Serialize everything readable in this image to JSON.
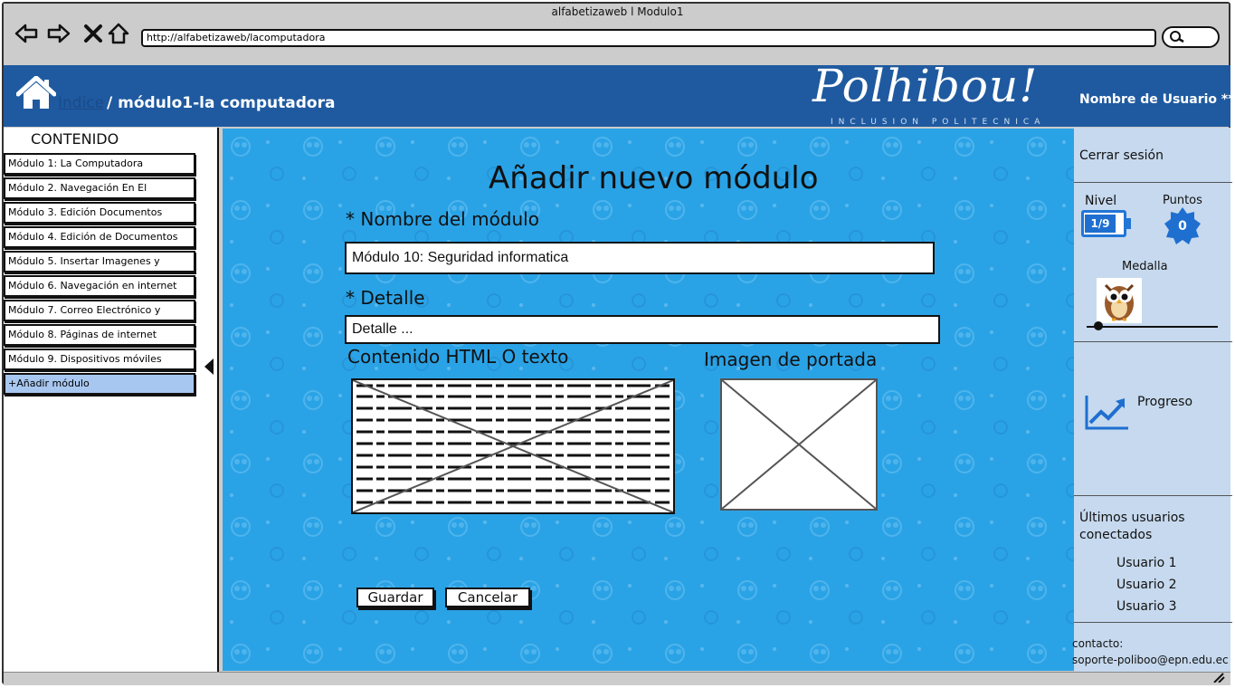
{
  "window": {
    "title": "alfabetizaweb l Modulo1",
    "url": "http://alfabetizaweb/lacomputadora"
  },
  "header": {
    "breadcrumb_link": "Indice",
    "breadcrumb_current": "/ módulo1-la computadora",
    "logo": "Polhibou!",
    "logo_subtitle": "INCLUSION POLITECNICA",
    "username": "Nombre de Usuario **"
  },
  "sidebar": {
    "title": "CONTENIDO",
    "items": [
      {
        "label": "Módulo 1: La Computadora"
      },
      {
        "label": "Módulo 2. Navegación En El"
      },
      {
        "label": "Módulo 3. Edición Documentos"
      },
      {
        "label": "Módulo 4. Edición de Documentos"
      },
      {
        "label": "Módulo 5. Insertar Imagenes y"
      },
      {
        "label": "Módulo 6. Navegación en internet"
      },
      {
        "label": "Módulo 7. Correo Electrónico y"
      },
      {
        "label": "Módulo 8. Páginas de internet"
      },
      {
        "label": "Módulo 9. Dispositivos móviles"
      },
      {
        "label": "+Añadir módulo"
      }
    ]
  },
  "form": {
    "title": "Añadir nuevo módulo",
    "name_label": "* Nombre del módulo",
    "name_value": "Módulo 10: Seguridad informatica",
    "detail_label": "* Detalle",
    "detail_value": "Detalle ...",
    "html_label": "Contenido HTML O texto",
    "cover_label": "Imagen de portada",
    "save_label": "Guardar",
    "cancel_label": "Cancelar"
  },
  "right_panel": {
    "logout": "Cerrar sesión",
    "level_label": "Nivel",
    "level_value": "1/9",
    "points_label": "Puntos",
    "points_value": "0",
    "medal_label": "Medalla",
    "progress_label": "Progreso",
    "last_users_title": "Últimos usuarios conectados",
    "users": [
      "Usuario 1",
      "Usuario 2",
      "Usuario 3"
    ],
    "contact_label": "contacto:",
    "contact_email": "soporte-poliboo@epn.edu.ec"
  },
  "colors": {
    "header": "#1f5aa0",
    "main_bg": "#2aa3e6",
    "right_bg": "#c6d9ee",
    "active_item": "#a8c7f0"
  }
}
